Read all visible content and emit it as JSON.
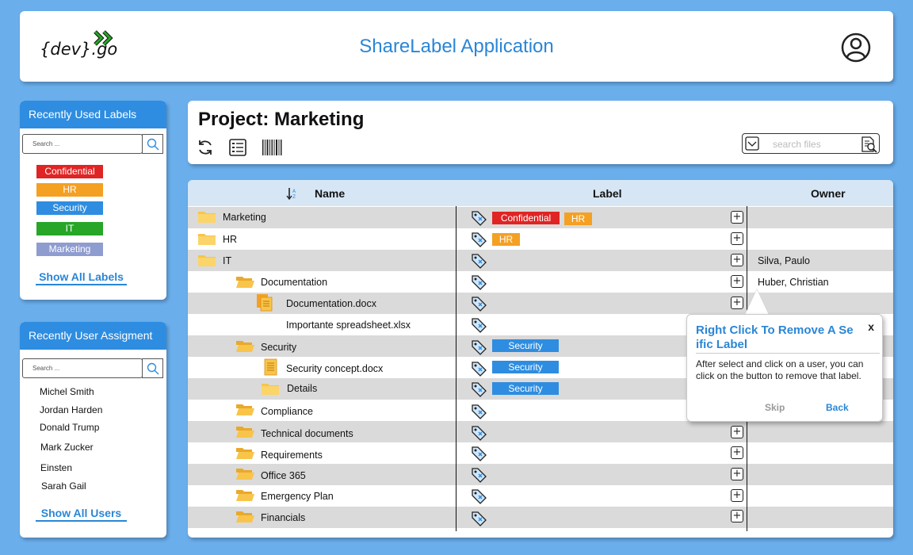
{
  "header": {
    "logo_text": "{dev}.go",
    "title": "ShareLabel Application"
  },
  "labels_panel": {
    "title": "Recently Used Labels",
    "search_placeholder": "Search ...",
    "labels": [
      {
        "text": "Confidential",
        "color": "#e02424"
      },
      {
        "text": "HR",
        "color": "#f4a023"
      },
      {
        "text": "Security",
        "color": "#2e8de0"
      },
      {
        "text": "IT",
        "color": "#27a627"
      },
      {
        "text": "Marketing",
        "color": "#8e9cd0"
      }
    ],
    "show_all": "Show All Labels"
  },
  "users_panel": {
    "title": "Recently User Assigment",
    "search_placeholder": "Search ...",
    "users": [
      "Michel Smith",
      "Jordan Harden",
      "Donald Trump",
      "Mark Zucker",
      "Einsten",
      "Sarah Gail"
    ],
    "show_all": "Show All Users"
  },
  "project": {
    "title": "Project: Marketing",
    "search_placeholder": "search files"
  },
  "table": {
    "headers": {
      "name": "Name",
      "label": "Label",
      "owner": "Owner"
    },
    "rows": [
      {
        "name": "Marketing",
        "icon": "folder-closed-icon",
        "owner": "",
        "labels": [
          "Confidential",
          "HR"
        ]
      },
      {
        "name": "HR",
        "icon": "folder-closed-icon",
        "owner": "",
        "labels": [
          "HR"
        ]
      },
      {
        "name": "IT",
        "icon": "folder-closed-icon",
        "owner": "Silva, Paulo",
        "labels": []
      },
      {
        "name": "Documentation",
        "icon": "folder-open-icon",
        "owner": "Huber, Christian",
        "labels": []
      },
      {
        "name": "Documentation.docx",
        "icon": "documents-icon",
        "owner": "",
        "labels": []
      },
      {
        "name": "Importante spreadsheet.xlsx",
        "icon": "",
        "owner": "",
        "labels": []
      },
      {
        "name": "Security",
        "icon": "folder-open-icon",
        "owner": "",
        "labels": [
          "Security"
        ]
      },
      {
        "name": "Security concept.docx",
        "icon": "document-icon",
        "owner": "",
        "labels": [
          "Security"
        ]
      },
      {
        "name": "Details",
        "icon": "folder-closed-icon",
        "owner": "",
        "labels": [
          "Security"
        ]
      },
      {
        "name": "Compliance",
        "icon": "folder-open-icon",
        "owner": "",
        "labels": []
      },
      {
        "name": "Technical documents",
        "icon": "folder-open-icon",
        "owner": "",
        "labels": []
      },
      {
        "name": "Requirements",
        "icon": "folder-open-icon",
        "owner": "",
        "labels": []
      },
      {
        "name": "Office 365",
        "icon": "folder-open-icon",
        "owner": "",
        "labels": []
      },
      {
        "name": "Emergency Plan",
        "icon": "folder-open-icon",
        "owner": "",
        "labels": []
      },
      {
        "name": "Financials",
        "icon": "folder-open-icon",
        "owner": "",
        "labels": []
      }
    ]
  },
  "tooltip": {
    "title": "Right Click To Remove A Se ific Label",
    "close": "x",
    "body": "After select and click on a user, you can click on the button to remove that label.",
    "skip": "Skip",
    "back": "Back"
  },
  "colors": {
    "background": "#6aaeec",
    "accent": "#2e8de0",
    "confidential": "#e02424",
    "hr": "#f4a023",
    "security": "#2e8de0",
    "it": "#27a627",
    "marketing": "#8e9cd0"
  }
}
